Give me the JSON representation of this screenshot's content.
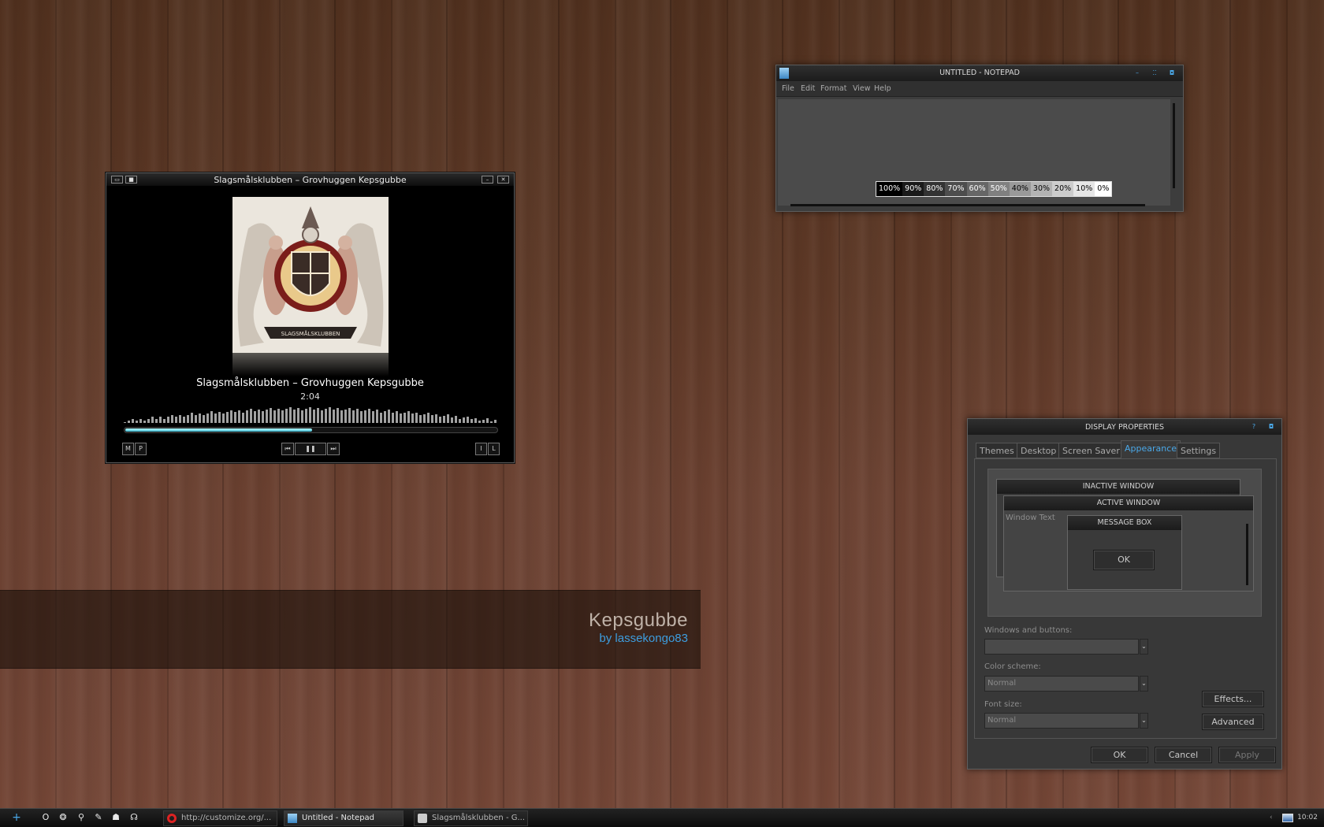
{
  "branding": {
    "title": "Kepsgubbe",
    "author": "by lassekongo83"
  },
  "player": {
    "window_title": "Slagsmålsklubben – Grovhuggen Kepsgubbe",
    "track": "Slagsmålsklubben – Grovhuggen Kepsgubbe",
    "time": "2:04",
    "progress": 0.5,
    "album_text": "SLAGSMÅLSKLUBBEN",
    "buttons": {
      "m": "M",
      "p": "P",
      "prev": "⏮",
      "pause": "❚❚",
      "next": "⏭",
      "i": "I",
      "l": "L"
    }
  },
  "notepad": {
    "title": "UNTITLED - NOTEPAD",
    "menu": [
      "File",
      "Edit",
      "Format",
      "View",
      "Help"
    ],
    "swatches": [
      "100%",
      "90%",
      "80%",
      "70%",
      "60%",
      "50%",
      "40%",
      "30%",
      "20%",
      "10%",
      "0%"
    ]
  },
  "display": {
    "title": "DISPLAY PROPERTIES",
    "help": "?",
    "tabs": [
      "Themes",
      "Desktop",
      "Screen Saver",
      "Appearance",
      "Settings"
    ],
    "active_tab": "Appearance",
    "preview": {
      "inactive": "INACTIVE WINDOW",
      "active": "ACTIVE WINDOW",
      "window_text": "Window Text",
      "message_box": "MESSAGE BOX",
      "ok": "OK"
    },
    "windows_buttons_label": "Windows and buttons:",
    "windows_buttons_value": "",
    "color_scheme_label": "Color scheme:",
    "color_scheme_value": "Normal",
    "font_size_label": "Font size:",
    "font_size_value": "Normal",
    "effects": "Effects...",
    "advanced": "Advanced",
    "ok": "OK",
    "cancel": "Cancel",
    "apply": "Apply"
  },
  "taskbar": {
    "start": "+",
    "tasks": [
      {
        "label": "http://customize.org/...",
        "icon": "opera-icon"
      },
      {
        "label": "Untitled - Notepad",
        "icon": "notepad-icon"
      },
      {
        "label": "Slagsmålsklubben - G...",
        "icon": "media-player-icon"
      }
    ],
    "clock": "10:02"
  },
  "colors": {
    "accent": "#4aa8e8",
    "seek": "#3fb6cf"
  }
}
